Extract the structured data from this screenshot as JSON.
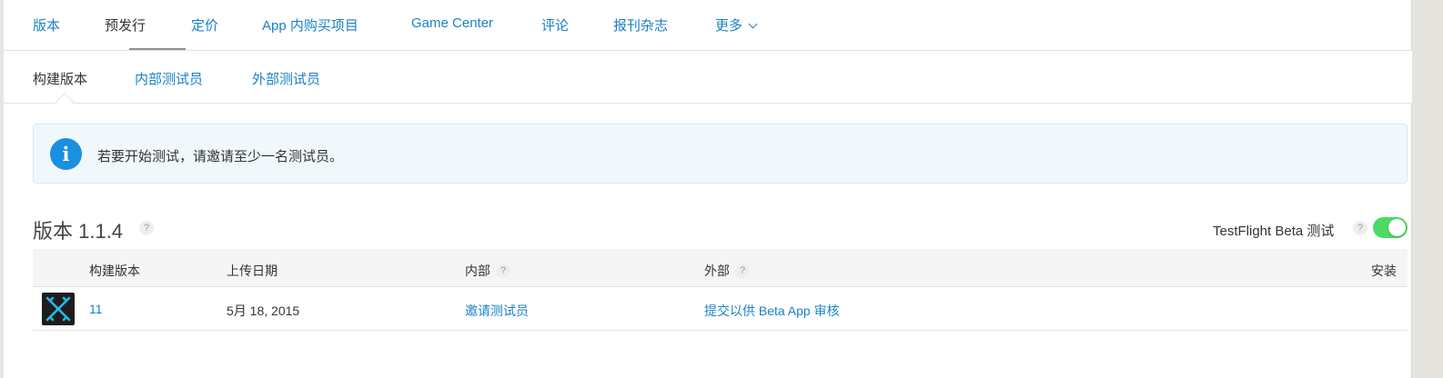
{
  "topnav": {
    "tabs": [
      {
        "label": "版本"
      },
      {
        "label": "预发行"
      },
      {
        "label": "定价"
      },
      {
        "label": "App 内购买项目"
      },
      {
        "label": "Game Center"
      },
      {
        "label": "评论"
      },
      {
        "label": "报刊杂志"
      },
      {
        "label": "更多"
      }
    ],
    "active": "预发行"
  },
  "subnav": {
    "tabs": [
      {
        "label": "构建版本"
      },
      {
        "label": "内部测试员"
      },
      {
        "label": "外部测试员"
      }
    ],
    "active": "构建版本"
  },
  "banner": {
    "icon": "info-icon",
    "icon_glyph": "i",
    "text": "若要开始测试，请邀请至少一名测试员。"
  },
  "version": {
    "title": "版本 1.1.4",
    "help": "?",
    "testflight_label": "TestFlight Beta 测试",
    "testflight_help": "?",
    "testflight_enabled": true
  },
  "table": {
    "columns": [
      {
        "label": "构建版本"
      },
      {
        "label": "上传日期"
      },
      {
        "label": "内部",
        "help": "?"
      },
      {
        "label": "外部",
        "help": "?"
      },
      {
        "label": "安装"
      }
    ],
    "rows": [
      {
        "build": "11",
        "upload_date": "5月 18, 2015",
        "internal": "邀请测试员",
        "external": "提交以供 Beta App 审核",
        "installs": ""
      }
    ]
  },
  "colors": {
    "link": "#1b82c4",
    "toggle_on": "#4cd964",
    "info": "#1a90e0",
    "app_icon_bg": "#1d1d1d",
    "app_icon_fg": "#29b6e8"
  }
}
